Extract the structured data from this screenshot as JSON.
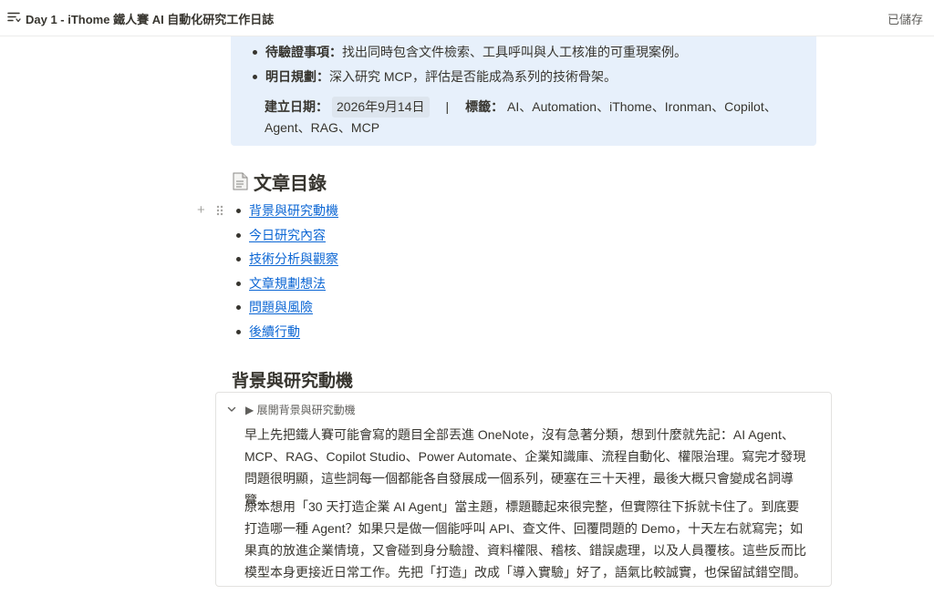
{
  "header": {
    "title": "Day 1 - iThome 鐵人賽 AI 自動化研究工作日誌",
    "saved_status": "已儲存",
    "menu_icon": "menu-lines-icon"
  },
  "callout": {
    "items": [
      {
        "label": "待驗證事項：",
        "text": "找出同時包含文件檢索、工具呼叫與人工核准的可重現案例。"
      },
      {
        "label": "明日規劃：",
        "text": "深入研究 MCP，評估是否能成為系列的技術骨架。"
      }
    ],
    "created_label": "建立日期：",
    "created_date": "2026年9月14日",
    "separator": "|",
    "tags_label": "標籤：",
    "tags_text": "AI、Automation、iThome、Ironman、Copilot、Agent、RAG、MCP",
    "background_color": "#e7f0fb"
  },
  "toc": {
    "heading": "文章目錄",
    "icon": "document-icon",
    "items": [
      "背景與研究動機",
      "今日研究內容",
      "技術分析與觀察",
      "文章規劃想法",
      "問題與風險",
      "後續行動"
    ],
    "link_color": "#0b66d4"
  },
  "section": {
    "heading": "背景與研究動機",
    "toggle_title": "▶ 展開背景與研究動機",
    "paragraphs": [
      "早上先把鐵人賽可能會寫的題目全部丟進 OneNote，沒有急著分類，想到什麼就先記：AI Agent、MCP、RAG、Copilot Studio、Power Automate、企業知識庫、流程自動化、權限治理。寫完才發現問題很明顯，這些詞每一個都能各自發展成一個系列，硬塞在三十天裡，最後大概只會變成名詞導覽。",
      "原本想用「30 天打造企業 AI Agent」當主題，標題聽起來很完整，但實際往下拆就卡住了。到底要打造哪一種 Agent？如果只是做一個能呼叫 API、查文件、回覆問題的 Demo，十天左右就寫完；如果真的放進企業情境，又會碰到身分驗證、資料權限、稽核、錯誤處理，以及人員覆核。這些反而比模型本身更接近日常工作。先把「打造」改成「導入實驗」好了，語氣比較誠實，也保留試錯空間。"
    ]
  }
}
